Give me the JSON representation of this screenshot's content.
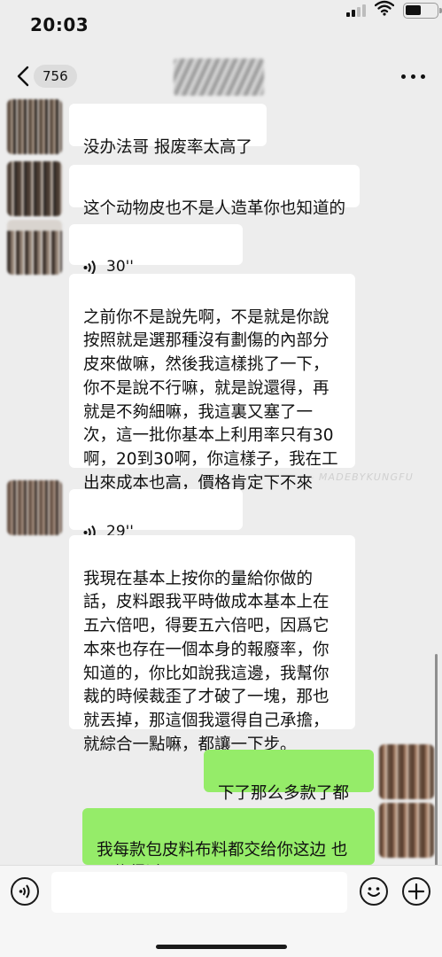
{
  "status_bar": {
    "time": "20:03"
  },
  "nav": {
    "unread_count": "756"
  },
  "messages": [
    {
      "side": "left",
      "type": "text",
      "text": "没办法哥 报废率太高了"
    },
    {
      "side": "left",
      "type": "text",
      "text": "这个动物皮也不是人造革你也知道的"
    },
    {
      "side": "left",
      "type": "voice",
      "duration": "30''"
    },
    {
      "side": "left",
      "type": "text",
      "text": "之前你不是說先啊，不是就是你說\n按照就是選那種沒有劃傷的內部分\n皮來做嘛，然後我這樣挑了一下，\n你不是說不行嘛，就是說還得，再\n就是不夠細嘛，我這裏又塞了一\n次，這一批你基本上利用率只有30\n啊，20到30啊，你這樣子，我在工\n出來成本也高，價格肯定下不來的。"
    },
    {
      "side": "left",
      "type": "voice",
      "duration": "29''"
    },
    {
      "side": "left",
      "type": "text",
      "text": "我現在基本上按你的量給你做的\n話，皮料跟我平時做成本基本上在\n五六倍吧，得要五六倍吧，因爲它\n本來也存在一個本身的報廢率，你\n知道的，你比如說我這邊，我幫你\n裁的時候裁歪了才破了一塊，那也\n就丟掉，那這個我還得自己承擔，\n就綜合一點嘛，都讓一下步。"
    },
    {
      "side": "right",
      "type": "text",
      "text": "下了那么多款了都"
    },
    {
      "side": "right",
      "type": "text",
      "text": "我每款包皮料布料都交给你这边 也\n是信得过"
    }
  ],
  "watermark": "- MADEBYKUNGFU",
  "icons": {
    "back": "chevron-left-icon",
    "more": "ellipsis-icon",
    "voice_input": "voice-input-icon",
    "emoji": "emoji-icon",
    "add": "plus-icon",
    "voice_message": "voice-wave-icon"
  },
  "colors": {
    "background": "#ededed",
    "bubble_incoming": "#ffffff",
    "bubble_outgoing": "#95ec69"
  }
}
